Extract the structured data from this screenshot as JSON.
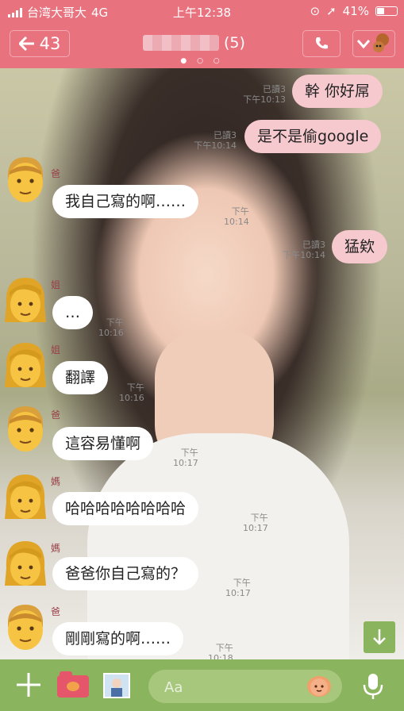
{
  "status_bar": {
    "carrier": "台湾大哥大",
    "network": "4G",
    "time": "上午12:38",
    "battery_percent": "41%",
    "battery_level": 0.41
  },
  "header": {
    "back_count": "43",
    "member_count": "(5)",
    "page_dots": "● ○ ○"
  },
  "messages": [
    {
      "type": "out",
      "text": "幹 你好屌",
      "read": "已讀3",
      "time": "下午10:13"
    },
    {
      "type": "out",
      "text": "是不是偷google",
      "read": "已讀3",
      "time": "下午10:14"
    },
    {
      "type": "in",
      "sender": "爸",
      "avatar": "dad-emoji",
      "text": "我自己寫的啊……",
      "time": "下午10:14"
    },
    {
      "type": "out",
      "text": "猛欸",
      "read": "已讀3",
      "time": "下午10:14"
    },
    {
      "type": "in",
      "sender": "姐",
      "avatar": "woman-emoji",
      "text": "…",
      "time": "下午10:16"
    },
    {
      "type": "in",
      "sender": "姐",
      "avatar": "woman-emoji",
      "text": "翻譯",
      "time": "下午10:16"
    },
    {
      "type": "in",
      "sender": "爸",
      "avatar": "dad-emoji",
      "text": "這容易懂啊",
      "time": "下午10:17"
    },
    {
      "type": "in",
      "sender": "媽",
      "avatar": "woman-emoji",
      "text": "哈哈哈哈哈哈哈哈",
      "time": "下午10:17"
    },
    {
      "type": "in",
      "sender": "媽",
      "avatar": "woman-emoji",
      "text": "爸爸你自己寫的？",
      "time": "下午10:17"
    },
    {
      "type": "in",
      "sender": "爸",
      "avatar": "dad-emoji",
      "text": "剛剛寫的啊……",
      "time": "下午10:18"
    }
  ],
  "composer": {
    "placeholder": "Aa"
  },
  "icons": {
    "back": "arrow-left-icon",
    "call": "phone-icon",
    "menu": "chevron-down-icon",
    "plus": "plus-icon",
    "folder": "folder-icon",
    "photo": "photo-icon",
    "sticker": "sticker-icon",
    "mic": "microphone-icon",
    "scroll": "arrow-down-icon"
  }
}
